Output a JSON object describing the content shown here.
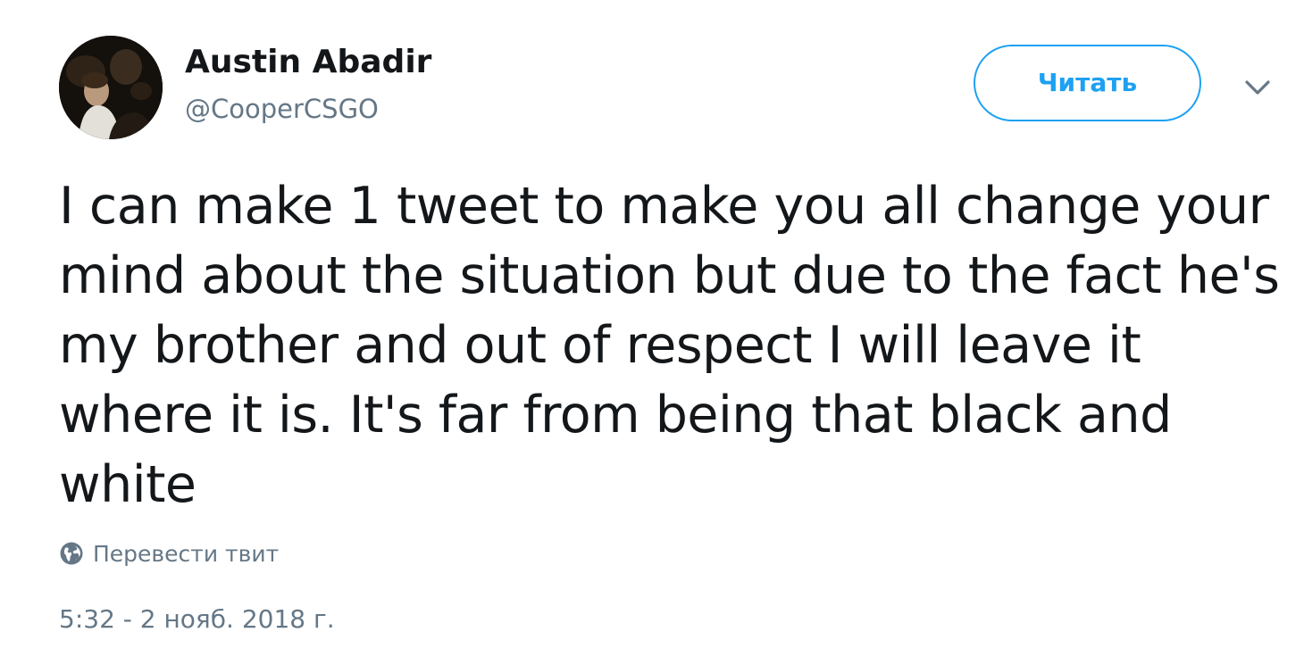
{
  "author": {
    "display_name": "Austin Abadir",
    "handle": "@CooperCSGO",
    "avatar_icon": "user-avatar-photo"
  },
  "follow_button": {
    "label": "Читать",
    "color": "#1da1f2"
  },
  "menu": {
    "icon": "chevron-down-icon"
  },
  "tweet": {
    "text": "I can make 1 tweet to make you all change your mind about the situation but due to the fact he's my brother and out of respect I will leave it where it is. It's far from being that black and white"
  },
  "translate": {
    "icon": "globe-icon",
    "label": "Перевести твит"
  },
  "timestamp": "5:32 - 2 нояб. 2018 г.",
  "colors": {
    "text": "#14171a",
    "secondary": "#657786",
    "accent": "#1da1f2"
  }
}
